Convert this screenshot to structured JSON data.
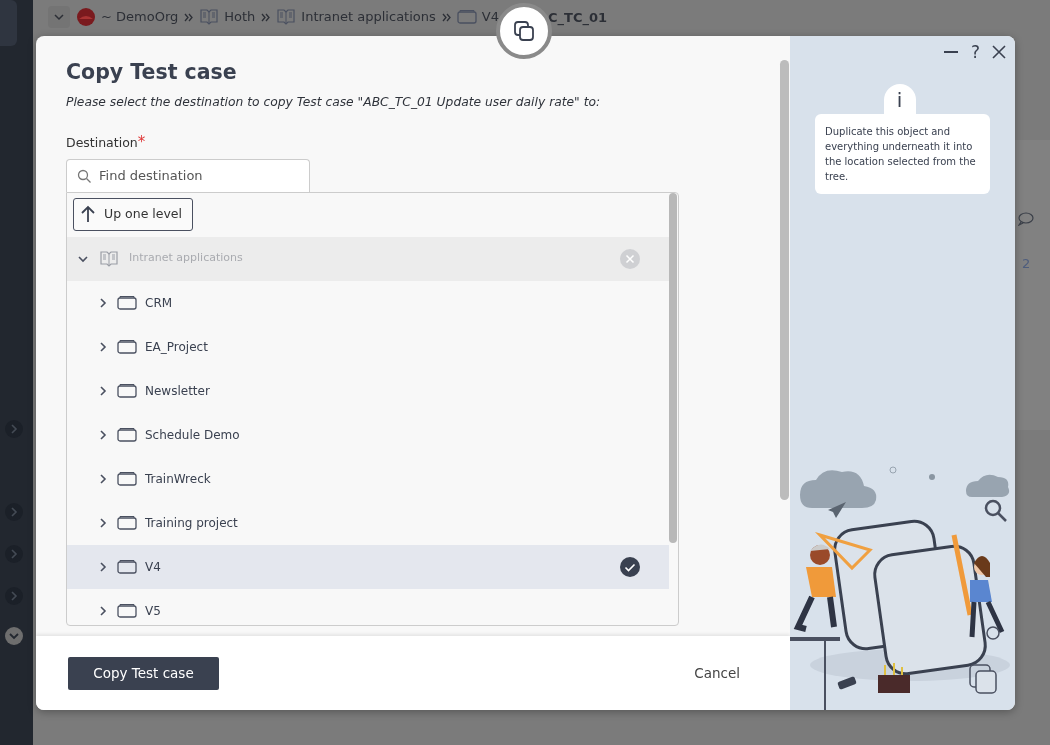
{
  "breadcrumb": [
    {
      "kind": "org",
      "label": "~ DemoOrg"
    },
    {
      "kind": "book",
      "label": "Hoth"
    },
    {
      "kind": "book",
      "label": "Intranet applications"
    },
    {
      "kind": "folder",
      "label": "V4"
    },
    {
      "kind": "current",
      "label": "C_TC_01"
    }
  ],
  "background": {
    "count": "2"
  },
  "dialog": {
    "title": "Copy Test case",
    "subtitle": "Please select the destination to copy Test case \"ABC_TC_01 Update user daily rate\" to:",
    "destination_label": "Destination",
    "required_mark": "*",
    "search": {
      "placeholder": "Find destination"
    },
    "up_button": "Up one level",
    "tree": {
      "label": "Intranet applications",
      "expanded": true,
      "disabled": true,
      "children": [
        {
          "label": "CRM",
          "expanded": false,
          "selected": false
        },
        {
          "label": "EA_Project",
          "expanded": false,
          "selected": false
        },
        {
          "label": "Newsletter",
          "expanded": false,
          "selected": false
        },
        {
          "label": "Schedule Demo",
          "expanded": false,
          "selected": false
        },
        {
          "label": "TrainWreck",
          "expanded": false,
          "selected": false
        },
        {
          "label": "Training project",
          "expanded": false,
          "selected": false
        },
        {
          "label": "V4",
          "expanded": false,
          "selected": true
        },
        {
          "label": "V5",
          "expanded": false,
          "selected": false
        }
      ]
    },
    "help_label": "?",
    "info_badge": "i",
    "info": "Duplicate this object and everything underneath it into the location selected from the tree.",
    "primary_button": "Copy Test case",
    "cancel_button": "Cancel"
  }
}
